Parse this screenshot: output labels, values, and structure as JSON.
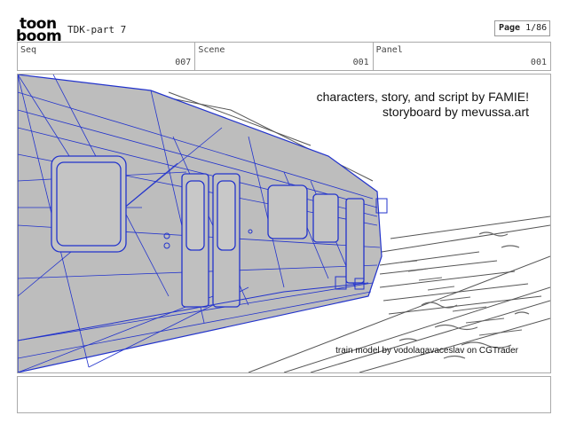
{
  "header": {
    "logo_line1": "toon",
    "logo_line2": "boom",
    "project_title": "TDK-part 7",
    "page_label": "Page",
    "page_value": "1/86"
  },
  "meta": {
    "seq_label": "Seq",
    "seq_value": "007",
    "scene_label": "Scene",
    "scene_value": "001",
    "panel_label": "Panel",
    "panel_value": "001"
  },
  "panel": {
    "credit_line1": "characters, story, and script by FAMIE!",
    "credit_line2": "storyboard by mevussa.art",
    "credit_model": "train model by vodolagavaceslav on CGTrader"
  },
  "colors": {
    "train_fill": "#bdbdbd",
    "wire": "#2233cc",
    "sketch": "#555555"
  }
}
